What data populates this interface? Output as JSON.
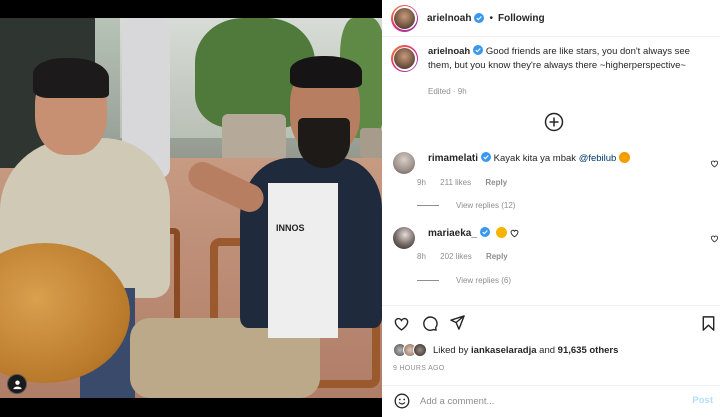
{
  "post": {
    "author": "arielnoah",
    "follow_status": "Following",
    "separator": "•",
    "caption": "Good friends are like stars, you don't always see them, but you know they're always there ~higherperspective~",
    "edited": "Edited · 9h",
    "video_shirt_text": "INNOS"
  },
  "comments": [
    {
      "username": "rimamelati",
      "text": "Kayak kita ya mbak",
      "mention": "@febilub",
      "time": "9h",
      "likes": "211 likes",
      "reply": "Reply",
      "view_replies": "View replies (12)"
    },
    {
      "username": "mariaeka_",
      "text": "",
      "time": "8h",
      "likes": "202 likes",
      "reply": "Reply",
      "view_replies": "View replies (6)"
    }
  ],
  "likes": {
    "prefix": "Liked by",
    "user": "iankaselaradja",
    "conj": "and",
    "others": "91,635 others"
  },
  "time_ago": "9 HOURS AGO",
  "comment_box": {
    "placeholder": "Add a comment...",
    "post_label": "Post"
  },
  "icons": {
    "verified": "verified-badge-icon",
    "add": "plus-circle-icon",
    "like": "heart-icon",
    "comment": "comment-icon",
    "share": "paper-plane-icon",
    "save": "bookmark-icon",
    "emoji": "smiley-icon",
    "user_tag": "user-tag-icon"
  },
  "colors": {
    "verified_blue": "#3897f0",
    "link_blue": "#00376b",
    "muted": "#8e8e8e",
    "post_disabled": "#b2dffc"
  }
}
